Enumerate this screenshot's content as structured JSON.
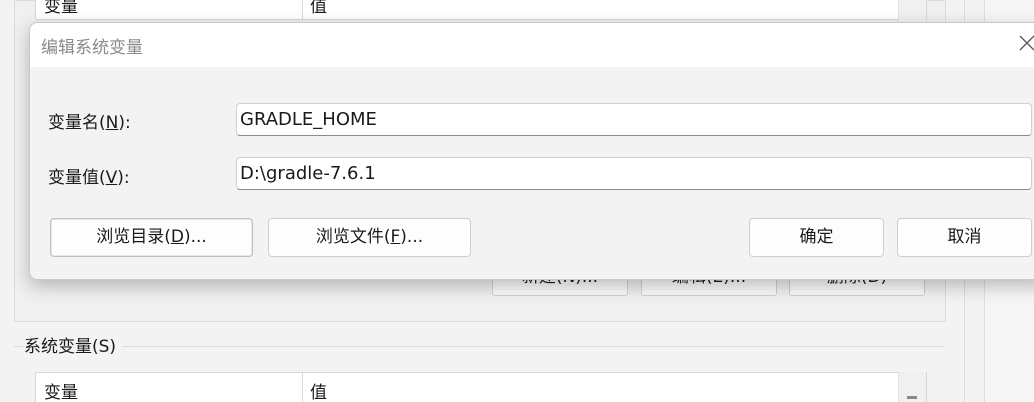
{
  "background": {
    "user_table": {
      "columns": [
        "变量",
        "值"
      ]
    },
    "user_buttons": {
      "new_label": "新建(N)...",
      "edit_label": "编辑(E)...",
      "delete_label": "删除(D)"
    },
    "system_group": {
      "label": "系统变量(S)",
      "columns": [
        "变量",
        "值"
      ]
    }
  },
  "dialog": {
    "title": "编辑系统变量",
    "name_field": {
      "label_prefix": "变量名(",
      "label_mnemonic": "N",
      "label_suffix": "):",
      "value": "GRADLE_HOME"
    },
    "value_field": {
      "label_prefix": "变量值(",
      "label_mnemonic": "V",
      "label_suffix": "):",
      "value": "D:\\gradle-7.6.1"
    },
    "browse_dir": {
      "prefix": "浏览目录(",
      "mnemonic": "D",
      "suffix": ")..."
    },
    "browse_file": {
      "prefix": "浏览文件(",
      "mnemonic": "F",
      "suffix": ")..."
    },
    "ok_label": "确定",
    "cancel_label": "取消"
  },
  "icons": {
    "close": "close-icon"
  },
  "colors": {
    "dialog_bg": "#f3f3f3",
    "titlebar_bg": "#ffffff",
    "title_text": "#8a8a8a"
  }
}
